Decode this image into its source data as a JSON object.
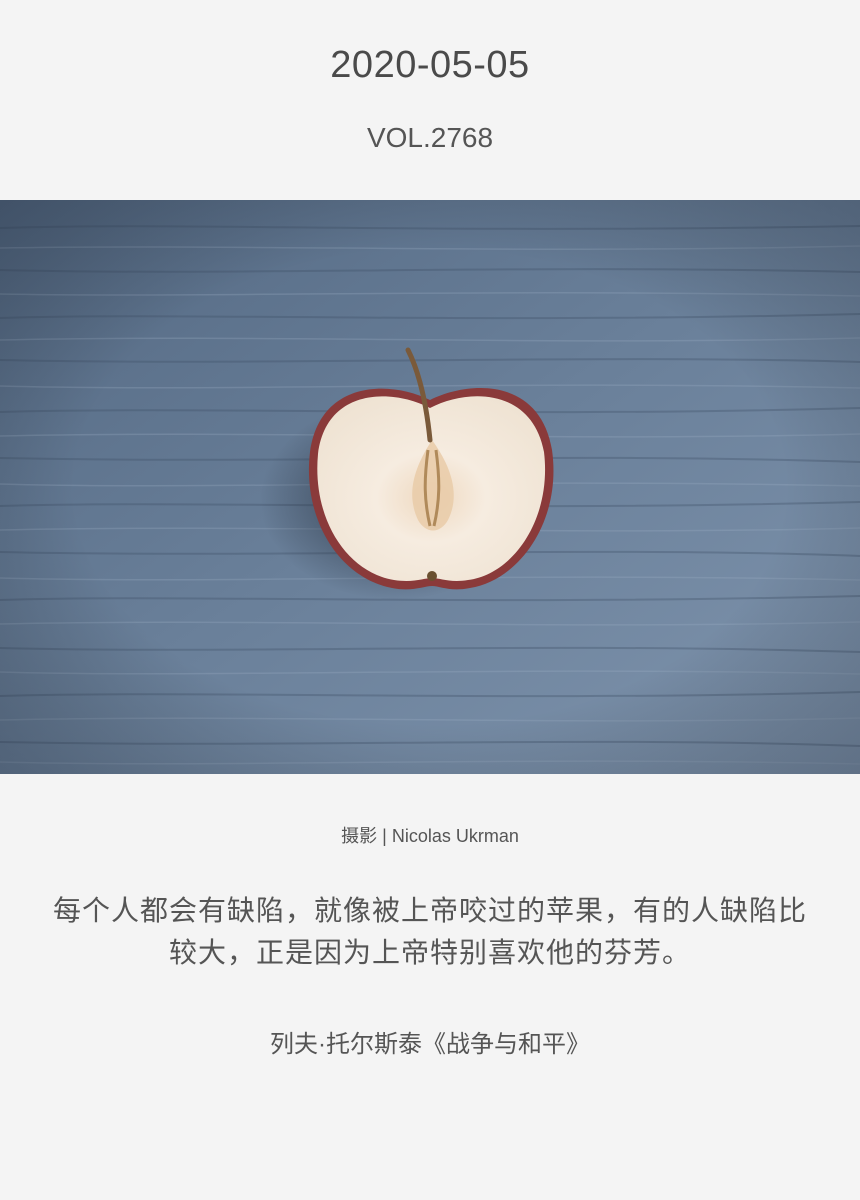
{
  "header": {
    "date": "2020-05-05",
    "volume": "VOL.2768"
  },
  "photo": {
    "subject": "half-apple-on-wooden-table",
    "colors": {
      "wood_base": "#5f7591",
      "apple_flesh": "#f1e6d8",
      "apple_skin": "#8a3a3a"
    }
  },
  "credit": "摄影 | Nicolas Ukrman",
  "quote": {
    "text": "每个人都会有缺陷，就像被上帝咬过的苹果，有的人缺陷比较大，正是因为上帝特别喜欢他的芬芳。",
    "source": "列夫·托尔斯泰《战争与和平》"
  }
}
